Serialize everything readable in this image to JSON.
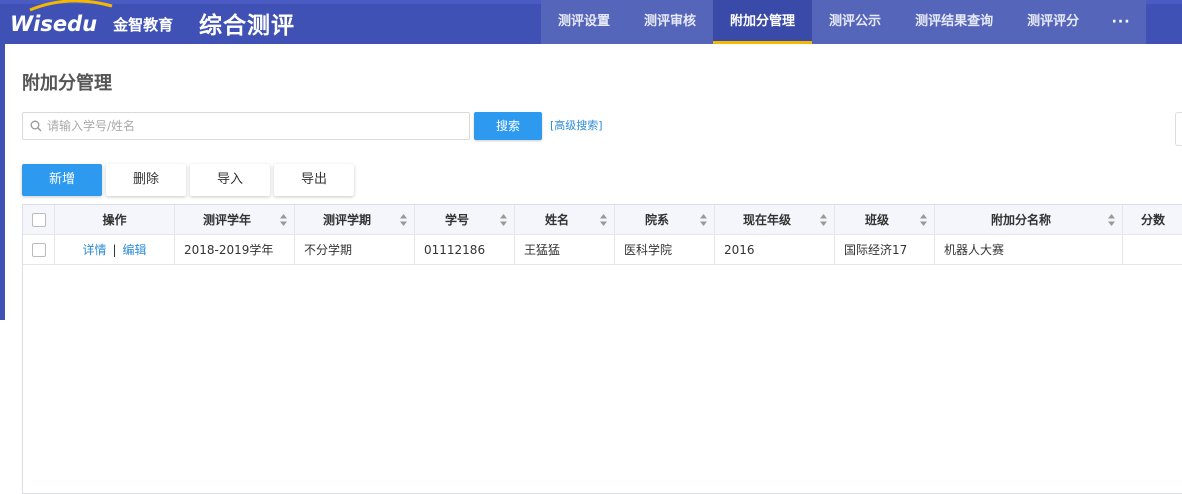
{
  "header": {
    "logo_text": "Wisedu",
    "logo_cn": "金智教育",
    "app_title": "综合测评",
    "nav": [
      {
        "label": "测评设置",
        "active": false
      },
      {
        "label": "测评审核",
        "active": false
      },
      {
        "label": "附加分管理",
        "active": true
      },
      {
        "label": "测评公示",
        "active": false
      },
      {
        "label": "测评结果查询",
        "active": false
      },
      {
        "label": "测评评分",
        "active": false
      }
    ],
    "more_label": "···"
  },
  "page": {
    "title": "附加分管理"
  },
  "search": {
    "placeholder": "请输入学号/姓名",
    "value": "",
    "button_label": "搜索",
    "advanced_label": "[高级搜索]"
  },
  "toolbar": {
    "add_label": "新增",
    "delete_label": "删除",
    "import_label": "导入",
    "export_label": "导出"
  },
  "table": {
    "columns": [
      "操作",
      "测评学年",
      "测评学期",
      "学号",
      "姓名",
      "院系",
      "现在年级",
      "班级",
      "附加分名称",
      "分数"
    ],
    "row_actions": {
      "detail": "详情",
      "separator": "|",
      "edit": "编辑"
    },
    "rows": [
      {
        "year": "2018-2019学年",
        "term": "不分学期",
        "student_no": "01112186",
        "name": "王猛猛",
        "dept": "医科学院",
        "grade": "2016",
        "class": "国际经济17",
        "bonus_name": "机器人大赛",
        "score": ""
      }
    ]
  },
  "colors": {
    "header_bg": "#3f51b5",
    "nav_active_underline": "#f5b800",
    "primary_button": "#2d9af0",
    "link": "#2d8cd8"
  }
}
